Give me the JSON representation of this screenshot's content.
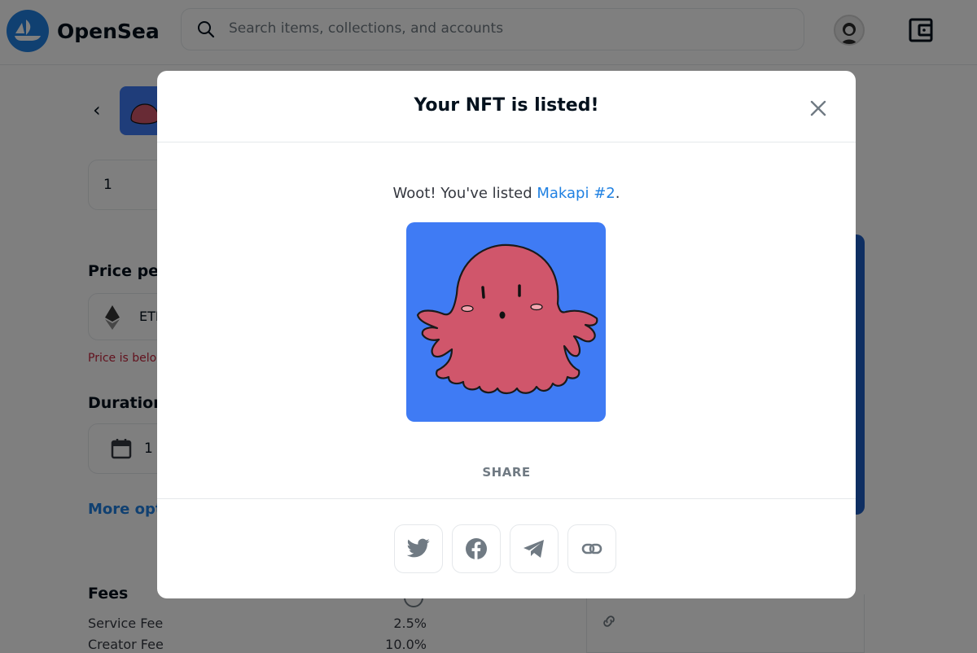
{
  "header": {
    "brand": "OpenSea",
    "search_placeholder": "Search items, collections, and accounts"
  },
  "background": {
    "quantity_value": "1",
    "price_heading": "Price per",
    "currency": "ETH",
    "price_warning": "Price is below",
    "duration_heading": "Duration",
    "duration_value": "1",
    "more_options": "More options",
    "fees_heading": "Fees",
    "fees": [
      {
        "label": "Service Fee",
        "value": "2.5%"
      },
      {
        "label": "Creator Fee",
        "value": "10.0%"
      }
    ]
  },
  "modal": {
    "title": "Your NFT is listed!",
    "message_prefix": "Woot! You've listed ",
    "nft_name": "Makapi #2",
    "message_suffix": ".",
    "share_label": "SHARE",
    "share_buttons": [
      "twitter-icon",
      "facebook-icon",
      "telegram-icon",
      "link-icon"
    ]
  },
  "colors": {
    "accent": "#2081e2",
    "nft_background": "#3f7bf4",
    "ghost": "#d0566b",
    "warning": "#c4253c"
  }
}
